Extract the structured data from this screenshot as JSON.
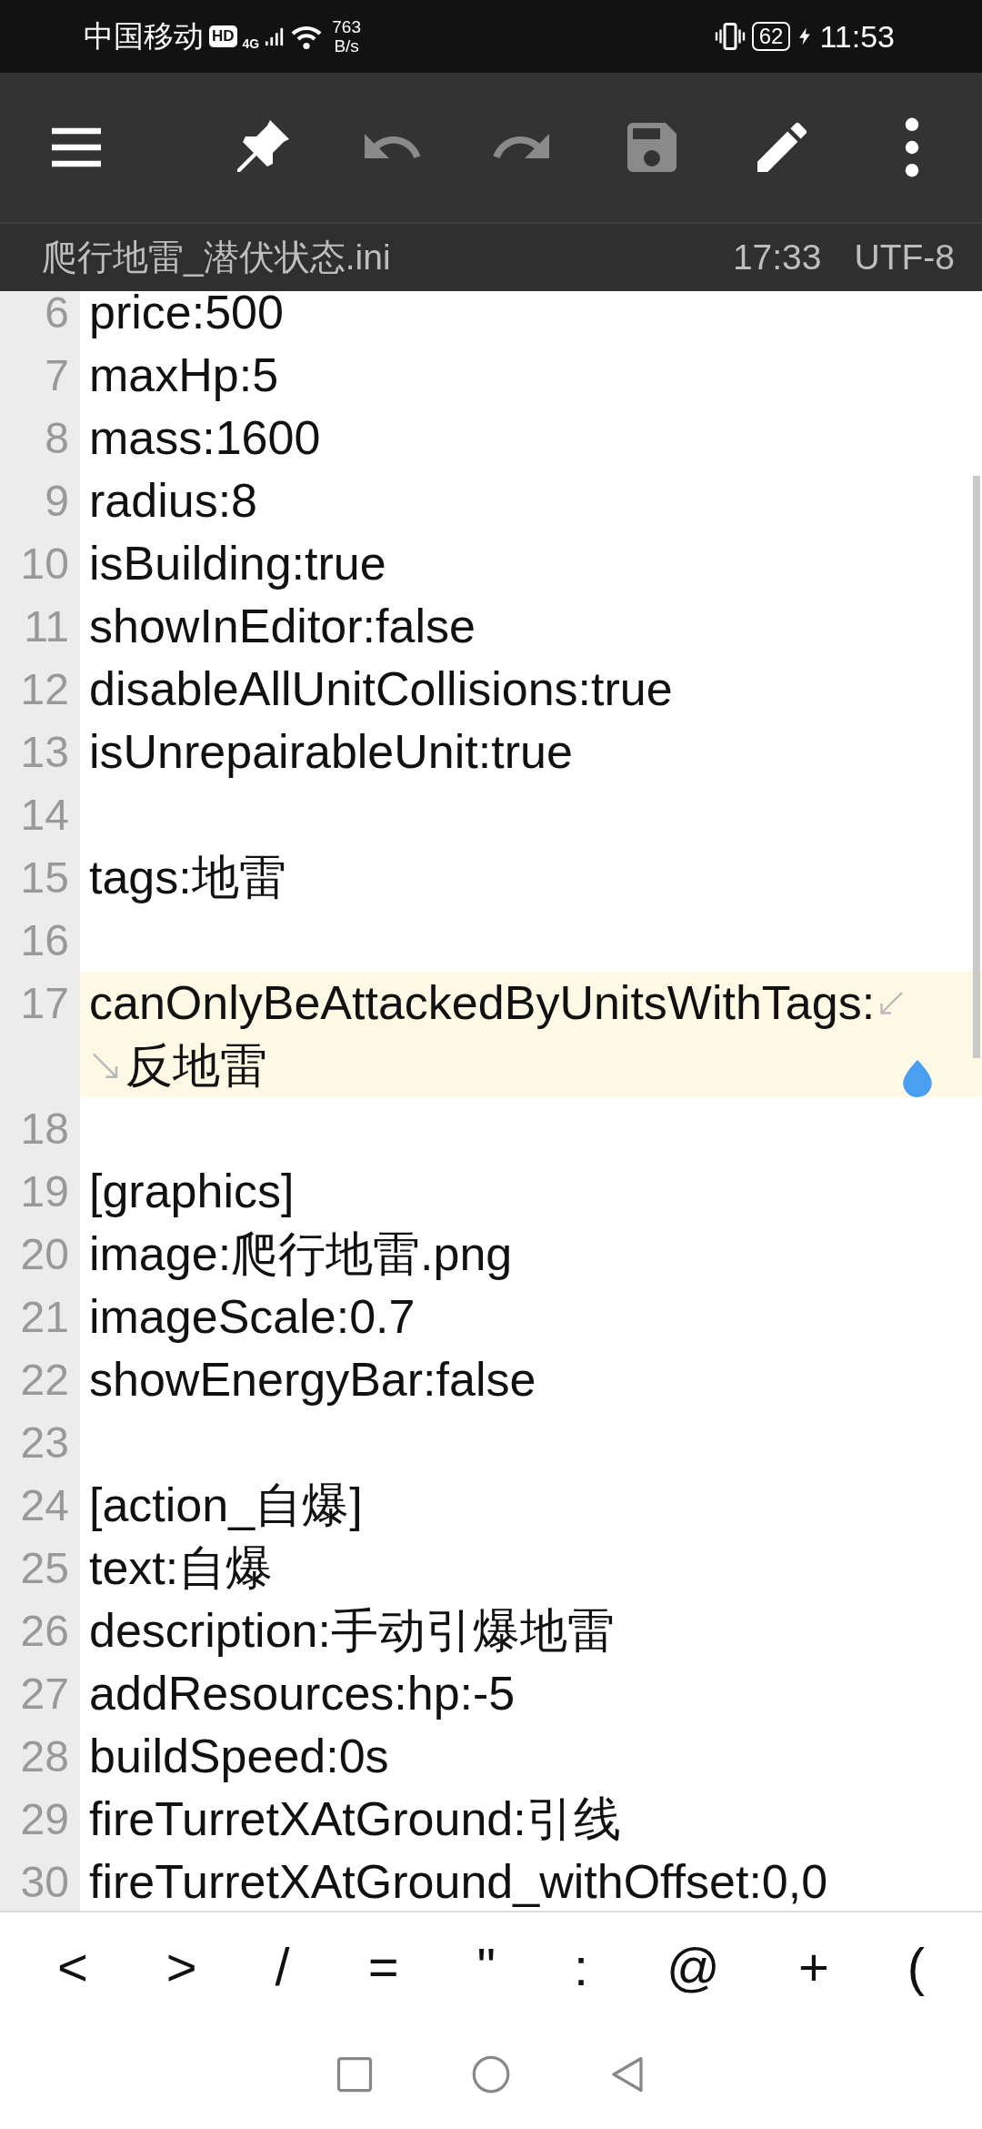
{
  "status_bar": {
    "carrier": "中国移动",
    "hd_badge": "HD",
    "network": "4G",
    "speed_value": "763",
    "speed_unit": "B/s",
    "battery": "62",
    "time": "11:53"
  },
  "toolbar": [
    {
      "kind": "menu",
      "disabled": false
    },
    {
      "kind": "pin",
      "disabled": false
    },
    {
      "kind": "undo",
      "disabled": true
    },
    {
      "kind": "redo",
      "disabled": true
    },
    {
      "kind": "save",
      "disabled": true
    },
    {
      "kind": "edit",
      "disabled": false
    },
    {
      "kind": "more",
      "disabled": false
    }
  ],
  "file_bar": {
    "file_name": "爬行地雷_潜伏状态.ini",
    "time": "17:33",
    "encoding": "UTF-8"
  },
  "editor": {
    "lines": [
      {
        "number": "6",
        "text": "price:500",
        "current": false
      },
      {
        "number": "7",
        "text": "maxHp:5",
        "current": false
      },
      {
        "number": "8",
        "text": "mass:1600",
        "current": false
      },
      {
        "number": "9",
        "text": "radius:8",
        "current": false
      },
      {
        "number": "10",
        "text": "isBuilding:true",
        "current": false
      },
      {
        "number": "11",
        "text": "showInEditor:false",
        "current": false
      },
      {
        "number": "12",
        "text": "disableAllUnitCollisions:true",
        "current": false
      },
      {
        "number": "13",
        "text": "isUnrepairableUnit:true",
        "current": false
      },
      {
        "number": "14",
        "current": false
      },
      {
        "number": "15",
        "text": "tags:地雷",
        "current": false
      },
      {
        "number": "16",
        "current": false
      },
      {
        "number": "17",
        "text": "canOnlyBeAttackedByUnitsWithTags:",
        "continuation": "反地雷",
        "current": true
      },
      {
        "number": "18",
        "current": false
      },
      {
        "number": "19",
        "text": "[graphics]",
        "current": false
      },
      {
        "number": "20",
        "text": "image:爬行地雷.png",
        "current": false
      },
      {
        "number": "21",
        "text": "imageScale:0.7",
        "current": false
      },
      {
        "number": "22",
        "text": "showEnergyBar:false",
        "current": false
      },
      {
        "number": "23",
        "current": false
      },
      {
        "number": "24",
        "text": "[action_自爆]",
        "current": false
      },
      {
        "number": "25",
        "text": "text:自爆",
        "current": false
      },
      {
        "number": "26",
        "text": "description:手动引爆地雷",
        "current": false
      },
      {
        "number": "27",
        "text": "addResources:hp:-5",
        "current": false
      },
      {
        "number": "28",
        "text": "buildSpeed:0s",
        "current": false
      },
      {
        "number": "29",
        "text": "fireTurretXAtGround:引线",
        "current": false
      },
      {
        "number": "30",
        "text": "fireTurretXAtGround_withOffset:0,0",
        "current": false
      }
    ]
  },
  "symbol_keys": [
    "<",
    ">",
    "/",
    "=",
    "\"",
    ":",
    "@",
    "+",
    "("
  ]
}
